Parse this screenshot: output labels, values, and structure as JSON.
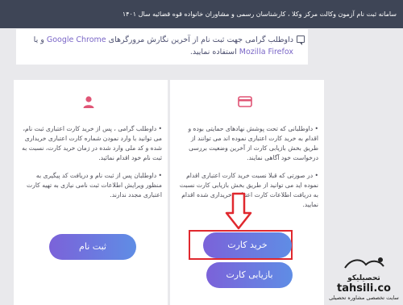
{
  "header": {
    "title": "سامانه ثبت نام آزمون وکالت مرکز وکلا ، کارشناسان رسمی و مشاوران خانواده قوه قضائیه سال ۱۴۰۱"
  },
  "notice": {
    "icon": "message-icon",
    "text_pre": "داوطلب گرامی جهت ثبت نام از آخرین نگارش مرورگرهای ",
    "brand1": "Google Chrome",
    "text_mid": " و یا ",
    "brand2": "Mozilla Firefox",
    "text_post": " استفاده نمایید."
  },
  "cards": {
    "buy": {
      "icon": "credit-card-icon",
      "para1": "• داوطلبانی که تحت پوشش نهادهای حمایتی بوده و اقدام به خرید کارت اعتباری نموده اند می توانند از طریق بخش بازیابی کارت از آخرین وضعیت بررسی درخواست خود آگاهی نمایند.",
      "para2": "• در صورتی که قبلا نسبت خرید کارت اعتباری اقدام نموده اید می توانید از طریق بخش بازیابی کارت نسبت به دریافت اطلاعات کارت اعتباری خریداری شده اقدام نمایید.",
      "buy_label": "خرید کارت",
      "recover_label": "بازیابی کارت"
    },
    "register": {
      "icon": "user-icon",
      "para1": "• داوطلب گرامی ، پس از خرید کارت اعتباری ثبت نام، می توانید با وارد نمودن شماره کارت اعتباری خریداری شده و کد ملی وارد شده در زمان خرید کارت، نسبت به ثبت نام خود اقدام نمائید.",
      "para2": "• داوطلبان پس از ثبت نام و دریافت کد پیگیری به منظور ویرایش اطلاعات ثبت نامی نیازی به تهیه کارت اعتباری مجدد ندارند.",
      "register_label": "ثبت نام"
    }
  },
  "watermark": {
    "logo_text": "تحصیلیکو",
    "site": "tahsili.co",
    "tagline": "سایت تخصصی مشاوره تحصیلی"
  },
  "colors": {
    "header_bg": "#3e4556",
    "accent": "#7a66c7",
    "highlight": "#e0282e",
    "icon_pink": "#e05576"
  }
}
